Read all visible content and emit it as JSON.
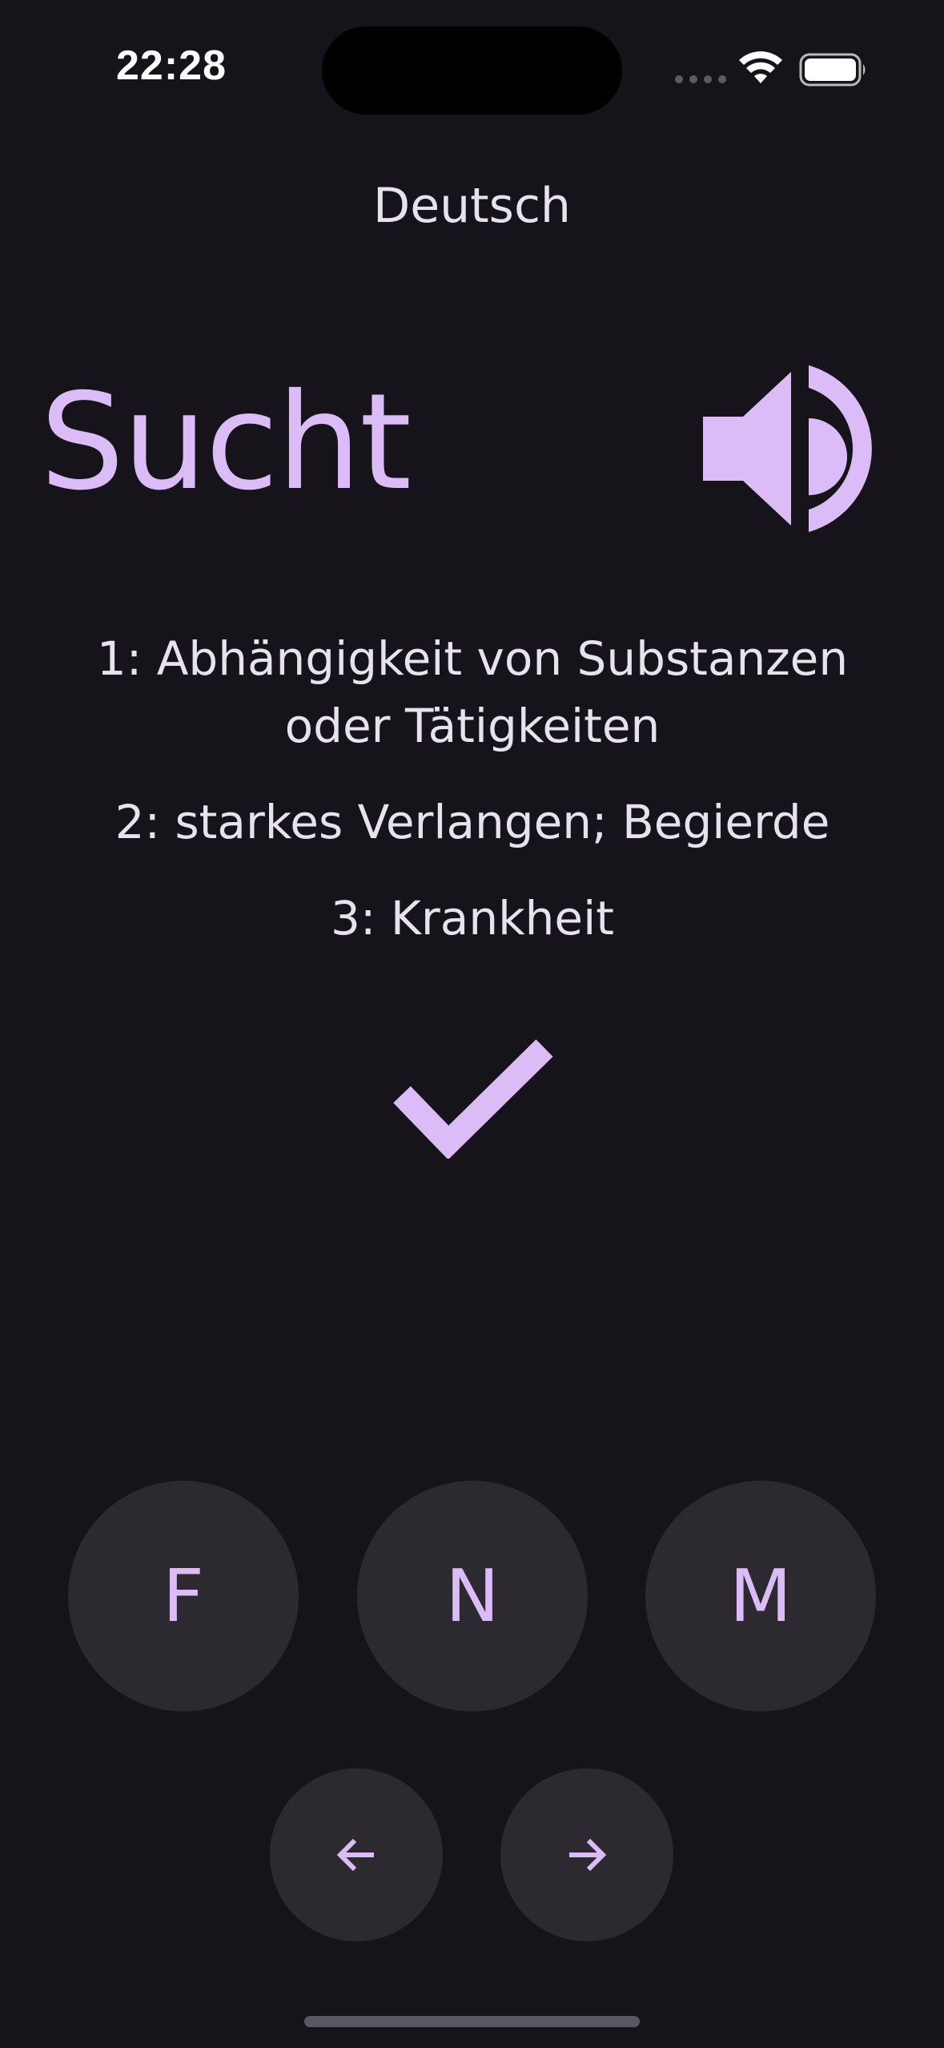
{
  "status_bar": {
    "time": "22:28"
  },
  "header": {
    "language": "Deutsch"
  },
  "card": {
    "word": "Sucht",
    "definitions": [
      "1: Abhängigkeit von Substanzen oder Tätigkeiten",
      "2: starkes Verlangen; Begierde",
      "3: Krankheit"
    ]
  },
  "gender_buttons": {
    "feminine": "F",
    "neuter": "N",
    "masculine": "M"
  },
  "icons": {
    "speaker": "speaker-icon",
    "check": "check-icon",
    "prev": "arrow-left-icon",
    "next": "arrow-right-icon"
  },
  "colors": {
    "background": "#16131a",
    "accent": "#dbbcf7",
    "button_bg": "#2c2930",
    "text": "#e8e2ee"
  }
}
